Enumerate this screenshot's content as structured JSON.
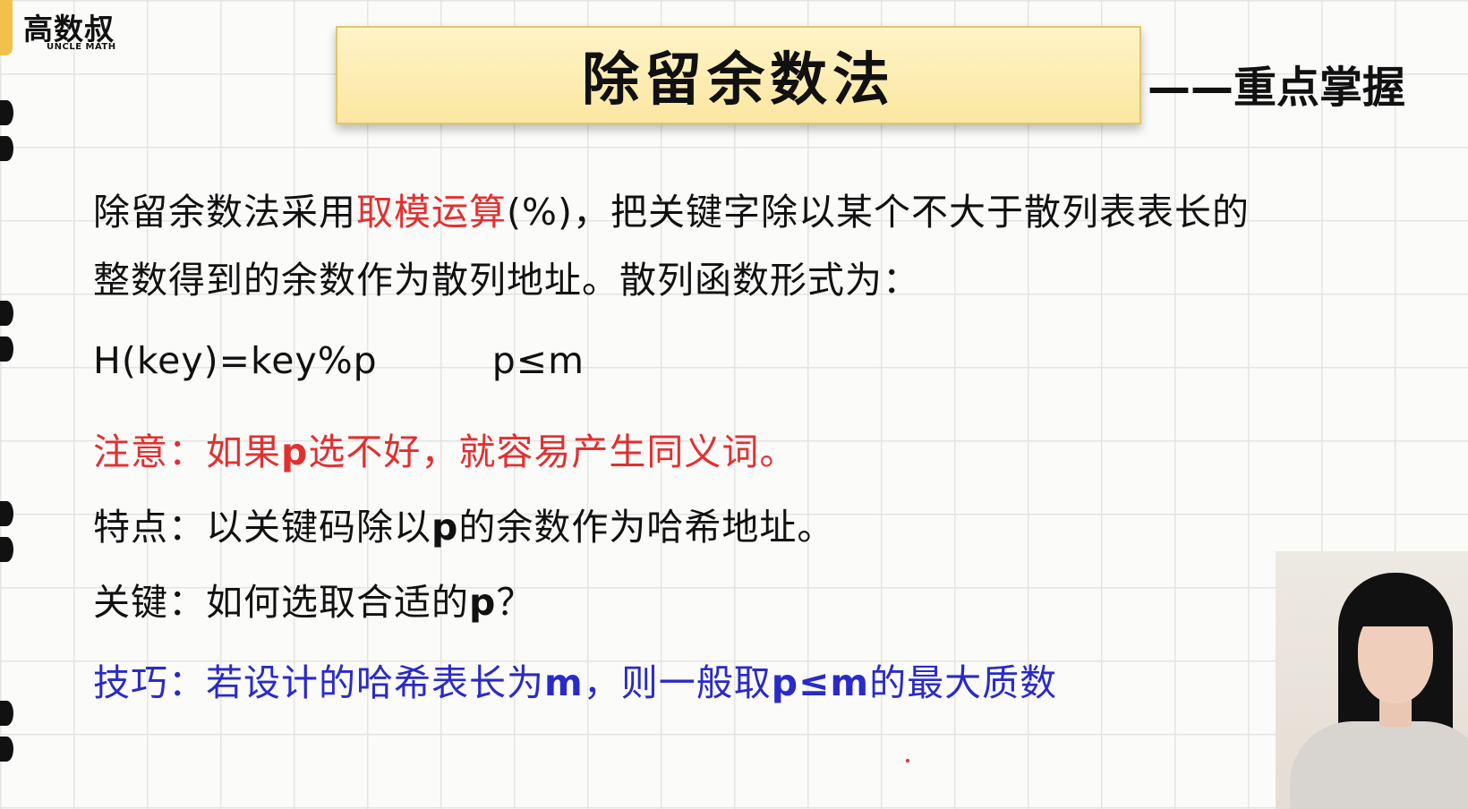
{
  "logo": {
    "main": "高数叔",
    "sub": "UNCLE MATH"
  },
  "title": "除留余数法",
  "subtitle": "——重点掌握",
  "paragraph": {
    "line1_prefix": "除留余数法采用",
    "line1_highlight": "取模运算",
    "line1_suffix": "(%)，把关键字除以某个不大于散列表表长的",
    "line2": "整数得到的余数作为散列地址。散列函数形式为："
  },
  "formula": {
    "left": "H(key)=key%p",
    "right": "p≤m"
  },
  "note": {
    "label": "注意：",
    "text_prefix": "如果",
    "var": "p",
    "text_suffix": "选不好，就容易产生同义词。"
  },
  "feature": {
    "label": "特点：",
    "text_prefix": "以关键码除以",
    "var": "p",
    "text_suffix": "的余数作为哈希地址。"
  },
  "key": {
    "label": "关键：",
    "text_prefix": "如何选取合适的",
    "var": "p",
    "text_suffix": "？"
  },
  "tip": {
    "label": "技巧：",
    "part1": "若设计的哈希表长为",
    "var1": "m",
    "part2": "，则一般取",
    "var2": "p≤m",
    "part3": "的最大质数"
  },
  "colors": {
    "accent_red": "#e23030",
    "accent_blue": "#2a2ac8",
    "title_bg": "#fbe7a0"
  }
}
